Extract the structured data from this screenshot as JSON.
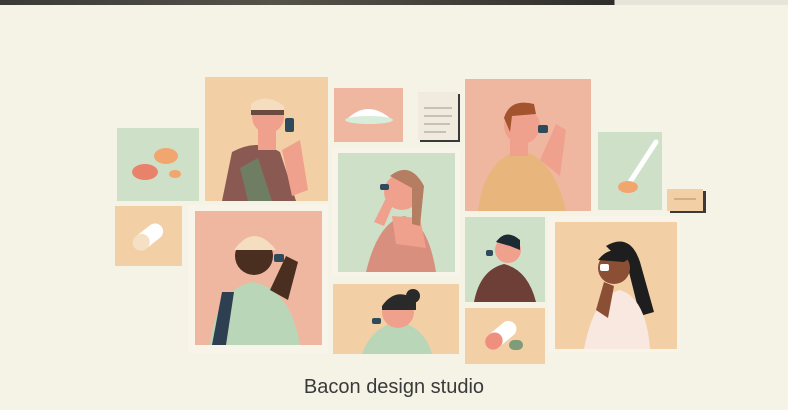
{
  "caption": "Bacon design studio",
  "colors": {
    "background": "#f5f2e6",
    "peach": "#f3cfa6",
    "salmon": "#efb7a0",
    "sage": "#cfe0c9",
    "text": "#3a3a3a"
  },
  "illustration": {
    "subject": "collage of people taking medication",
    "icons": [
      "pills-icon",
      "pill-capsule-icon",
      "powder-icon",
      "note-icon",
      "spoon-icon"
    ]
  }
}
